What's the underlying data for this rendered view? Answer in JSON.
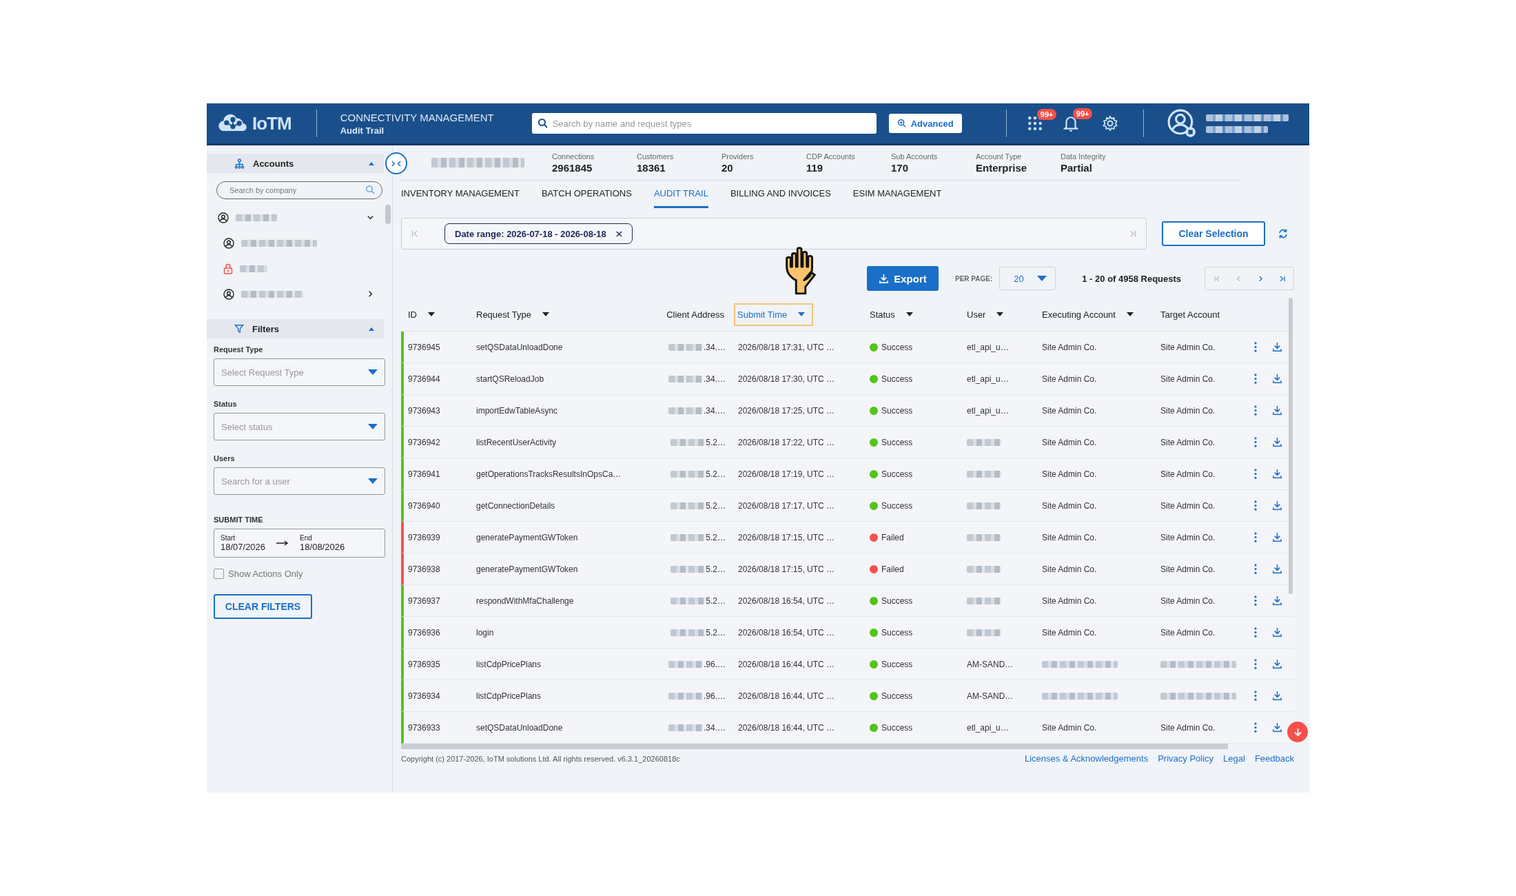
{
  "header": {
    "brand": "IoTM",
    "app_title": "CONNECTIVITY MANAGEMENT",
    "page_title": "Audit Trail",
    "search": {
      "placeholder": "Search by name and request types"
    },
    "advanced_button": "Advanced",
    "apps_badge": "99+",
    "notifications_badge": "99+"
  },
  "sidebar": {
    "accounts": {
      "title": "Accounts",
      "expanded": true,
      "search": {
        "placeholder": "Search by company"
      },
      "tree": [
        {
          "kind": "account",
          "expanded": true,
          "children": [
            {
              "kind": "account"
            },
            {
              "kind": "locked"
            },
            {
              "kind": "account",
              "expanded": false
            }
          ]
        }
      ]
    },
    "filters": {
      "title": "Filters",
      "expanded": true,
      "fields": [
        {
          "label": "Request Type",
          "placeholder": "Select Request Type"
        },
        {
          "label": "Status",
          "placeholder": "Select status"
        },
        {
          "label": "Users",
          "placeholder": "Search for a user"
        }
      ],
      "submit_time": {
        "title": "SUBMIT TIME",
        "start_label": "Start",
        "start": "18/07/2026",
        "end_label": "End",
        "end": "18/08/2026"
      },
      "show_actions_only": {
        "label": "Show Actions Only",
        "checked": false
      },
      "clear_button": "CLEAR FILTERS"
    }
  },
  "stats": [
    {
      "label": "Connections",
      "value": "2961845"
    },
    {
      "label": "Customers",
      "value": "18361"
    },
    {
      "label": "Providers",
      "value": "20"
    },
    {
      "label": "CDP Accounts",
      "value": "119"
    },
    {
      "label": "Sub Accounts",
      "value": "170"
    },
    {
      "label": "Account Type",
      "value": "Enterprise"
    },
    {
      "label": "Data Integrity",
      "value": "Partial"
    }
  ],
  "tabs": [
    {
      "label": "INVENTORY MANAGEMENT",
      "selected": false
    },
    {
      "label": "BATCH OPERATIONS",
      "selected": false
    },
    {
      "label": "AUDIT TRAIL",
      "selected": true
    },
    {
      "label": "BILLING AND INVOICES",
      "selected": false
    },
    {
      "label": "ESIM MANAGEMENT",
      "selected": false
    }
  ],
  "filter_bar": {
    "chip": "Date range: 2026-07-18 - 2026-08-18",
    "clear_selection": "Clear Selection"
  },
  "toolbar": {
    "export": "Export",
    "per_page_label": "PER PAGE:",
    "per_page": "20",
    "range": "1 - 20 of 4958 Requests",
    "pager": [
      {
        "kind": "first",
        "disabled": true
      },
      {
        "kind": "prev",
        "disabled": true
      },
      {
        "kind": "next",
        "disabled": false
      },
      {
        "kind": "last",
        "disabled": false
      }
    ]
  },
  "table": {
    "columns": [
      {
        "label": "ID",
        "sortable": true,
        "selected": false
      },
      {
        "label": "Request Type",
        "sortable": true,
        "selected": false
      },
      {
        "label": "Client Address",
        "sortable": false,
        "selected": false
      },
      {
        "label": "Submit Time",
        "sortable": true,
        "selected": true
      },
      {
        "label": "Status",
        "sortable": true,
        "selected": false
      },
      {
        "label": "User",
        "sortable": true,
        "selected": false
      },
      {
        "label": "Executing Account",
        "sortable": true,
        "selected": false
      },
      {
        "label": "Target Account",
        "sortable": false,
        "selected": false
      }
    ],
    "rows": [
      {
        "id": "9736945",
        "request_type": "setQSDataUnloadDone",
        "client_address": ".34.…",
        "submit_time": "2026/08/18 17:31, UTC …",
        "status": "Success",
        "color": "#52c41a",
        "user": "etl_api_u…",
        "executing_account": "Site Admin Co.",
        "target_account": "Site Admin Co."
      },
      {
        "id": "9736944",
        "request_type": "startQSReloadJob",
        "client_address": ".34.…",
        "submit_time": "2026/08/18 17:30, UTC …",
        "status": "Success",
        "color": "#52c41a",
        "user": "etl_api_u…",
        "executing_account": "Site Admin Co.",
        "target_account": "Site Admin Co."
      },
      {
        "id": "9736943",
        "request_type": "importEdwTableAsync",
        "client_address": ".34.…",
        "submit_time": "2026/08/18 17:25, UTC …",
        "status": "Success",
        "color": "#52c41a",
        "user": "etl_api_u…",
        "executing_account": "Site Admin Co.",
        "target_account": "Site Admin Co."
      },
      {
        "id": "9736942",
        "request_type": "listRecentUserActivity",
        "client_address": "5.2…",
        "submit_time": "2026/08/18 17:22, UTC …",
        "status": "Success",
        "color": "#52c41a",
        "executing_account": "Site Admin Co.",
        "target_account": "Site Admin Co."
      },
      {
        "id": "9736941",
        "request_type": "getOperationsTracksResultsInOpsCa…",
        "client_address": "5.2…",
        "submit_time": "2026/08/18 17:19, UTC …",
        "status": "Success",
        "color": "#52c41a",
        "executing_account": "Site Admin Co.",
        "target_account": "Site Admin Co."
      },
      {
        "id": "9736940",
        "request_type": "getConnectionDetails",
        "client_address": "5.2…",
        "submit_time": "2026/08/18 17:17, UTC …",
        "status": "Success",
        "color": "#52c41a",
        "executing_account": "Site Admin Co.",
        "target_account": "Site Admin Co."
      },
      {
        "id": "9736939",
        "request_type": "generatePaymentGWToken",
        "client_address": "5.2…",
        "submit_time": "2026/08/18 17:15, UTC …",
        "status": "Failed",
        "color": "#f5504a",
        "executing_account": "Site Admin Co.",
        "target_account": "Site Admin Co."
      },
      {
        "id": "9736938",
        "request_type": "generatePaymentGWToken",
        "client_address": "5.2…",
        "submit_time": "2026/08/18 17:15, UTC …",
        "status": "Failed",
        "color": "#f5504a",
        "executing_account": "Site Admin Co.",
        "target_account": "Site Admin Co."
      },
      {
        "id": "9736937",
        "request_type": "respondWithMfaChallenge",
        "client_address": "5.2…",
        "submit_time": "2026/08/18 16:54, UTC …",
        "status": "Success",
        "color": "#52c41a",
        "executing_account": "Site Admin Co.",
        "target_account": "Site Admin Co."
      },
      {
        "id": "9736936",
        "request_type": "login",
        "client_address": "5.2…",
        "submit_time": "2026/08/18 16:54, UTC …",
        "status": "Success",
        "color": "#52c41a",
        "executing_account": "Site Admin Co.",
        "target_account": "Site Admin Co."
      },
      {
        "id": "9736935",
        "request_type": "listCdpPricePlans",
        "client_address": ".96.…",
        "submit_time": "2026/08/18 16:44, UTC …",
        "status": "Success",
        "color": "#52c41a",
        "user": "AM-SAND…"
      },
      {
        "id": "9736934",
        "request_type": "listCdpPricePlans",
        "client_address": ".96.…",
        "submit_time": "2026/08/18 16:44, UTC …",
        "status": "Success",
        "color": "#52c41a",
        "user": "AM-SAND…"
      },
      {
        "id": "9736933",
        "request_type": "setQSDataUnloadDone",
        "client_address": ".34.…",
        "submit_time": "2026/08/18 16:44, UTC …",
        "status": "Success",
        "color": "#52c41a",
        "user": "etl_api_u…",
        "executing_account": "Site Admin Co.",
        "target_account": "Site Admin Co."
      }
    ]
  },
  "footer": {
    "copyright": "Copyright (c) 2017-2026, IoTM solutions Ltd. All rights reserved. v6.3.1_20260818c",
    "links": [
      "Licenses & Acknowledgements",
      "Privacy Policy",
      "Legal",
      "Feedback"
    ]
  }
}
